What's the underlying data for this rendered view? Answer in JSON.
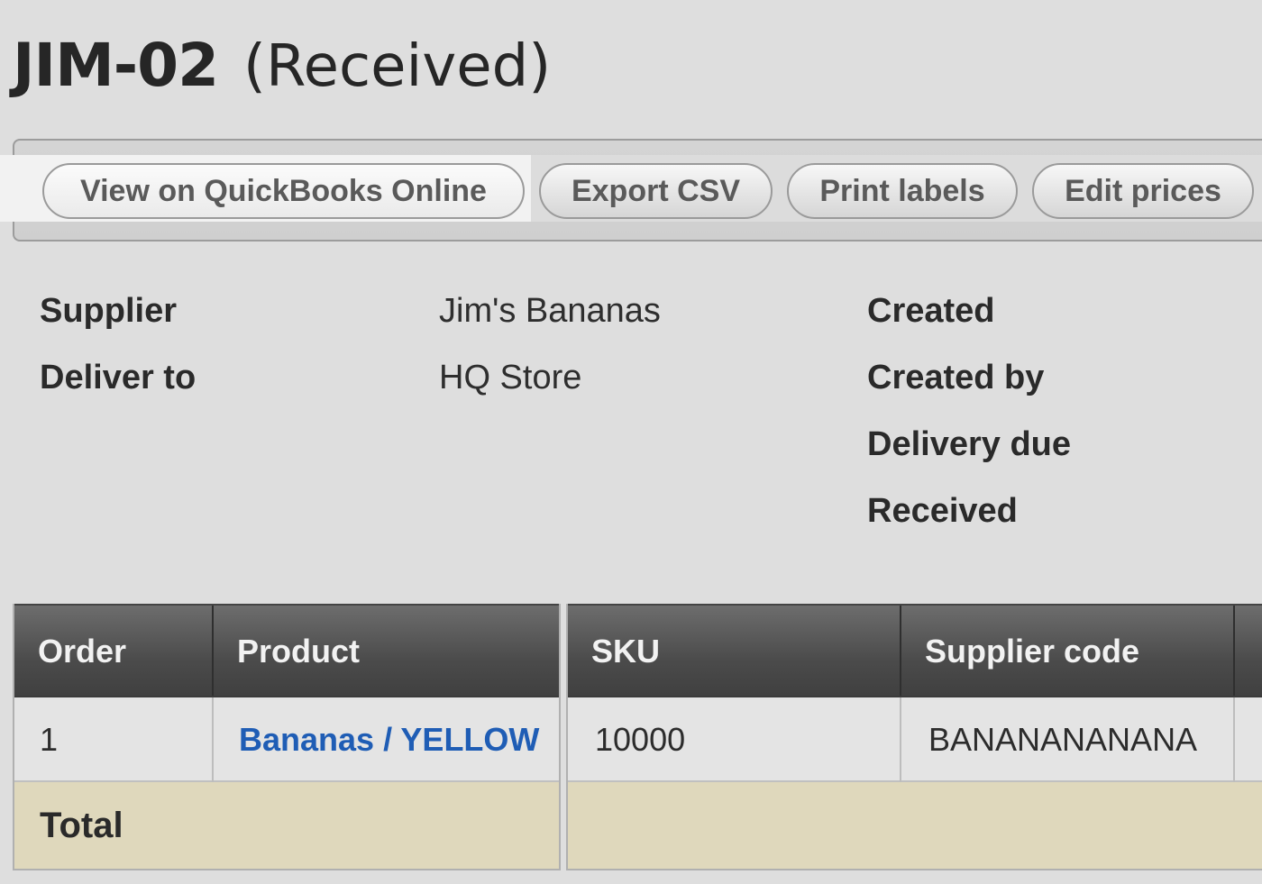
{
  "header": {
    "order_code": "JIM-02",
    "status": "(Received)"
  },
  "toolbar": {
    "qbo_label": "View on QuickBooks Online",
    "export_label": "Export CSV",
    "print_label": "Print labels",
    "edit_label": "Edit prices"
  },
  "details": {
    "supplier_label": "Supplier",
    "supplier_value": "Jim's Bananas",
    "deliver_label": "Deliver to",
    "deliver_value": "HQ Store",
    "created_label": "Created",
    "created_by_label": "Created by",
    "delivery_due_label": "Delivery due",
    "received_label": "Received"
  },
  "table": {
    "columns": [
      "Order",
      "Product",
      "SKU",
      "Supplier code"
    ],
    "rows": [
      {
        "order": "1",
        "product": "Bananas / YELLOW",
        "sku": "10000",
        "supplier_code": "BANANANANANA"
      }
    ],
    "total_label": "Total"
  },
  "colors": {
    "background": "#dedede",
    "link": "#1f5db5",
    "header_bg": "#4b4b4b",
    "total_bg": "#dfd8bc"
  }
}
